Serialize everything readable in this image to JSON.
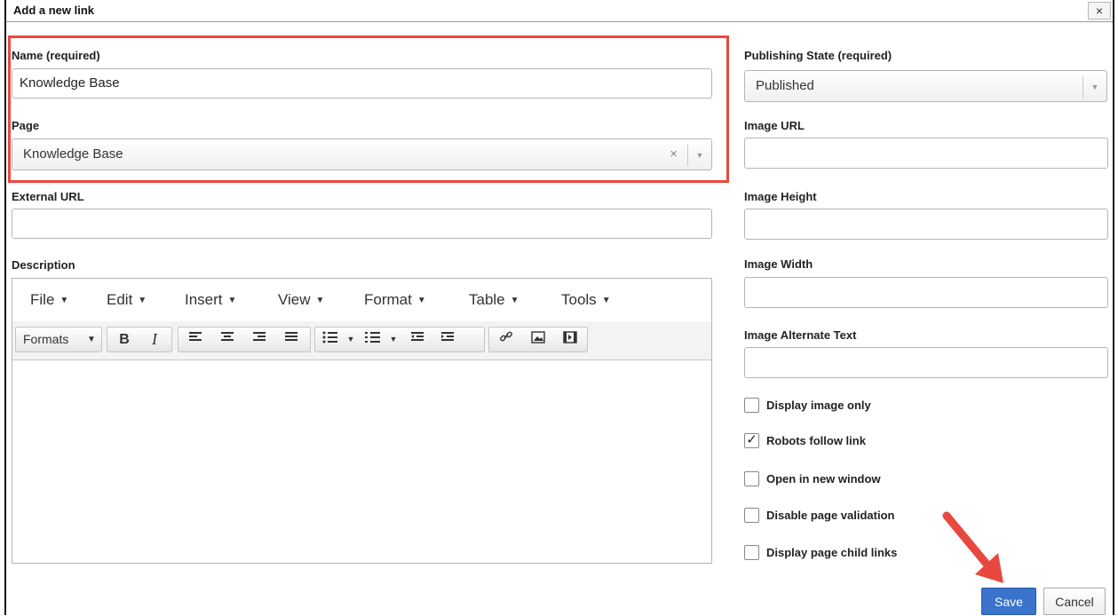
{
  "dialog": {
    "title": "Add a new link",
    "close": "×"
  },
  "left": {
    "name_label": "Name (required)",
    "name_value": "Knowledge Base",
    "page_label": "Page",
    "page_value": "Knowledge Base",
    "page_clear": "×",
    "external_url_label": "External URL",
    "external_url_value": "",
    "description_label": "Description"
  },
  "editor": {
    "menus": [
      "File",
      "Edit",
      "Insert",
      "View",
      "Format",
      "Table",
      "Tools"
    ],
    "toolbar": {
      "formats": "Formats",
      "bold": "B",
      "italic": "I"
    }
  },
  "right": {
    "publishing_label": "Publishing State (required)",
    "publishing_value": "Published",
    "image_url_label": "Image URL",
    "image_height_label": "Image Height",
    "image_width_label": "Image Width",
    "image_alt_label": "Image Alternate Text"
  },
  "checkboxes": [
    {
      "label": "Display image only",
      "checked": false
    },
    {
      "label": "Robots follow link",
      "checked": true
    },
    {
      "label": "Open in new window",
      "checked": false
    },
    {
      "label": "Disable page validation",
      "checked": false
    },
    {
      "label": "Display page child links",
      "checked": false
    }
  ],
  "buttons": {
    "save": "Save",
    "cancel": "Cancel"
  },
  "colors": {
    "highlight": "#e8483f",
    "primary": "#3a73cc",
    "arrow": "#e8483f"
  },
  "icons": {
    "dropdown": "chevron-down-icon",
    "toolbar": [
      "align-left-icon",
      "align-center-icon",
      "align-right-icon",
      "align-justify-icon",
      "bullet-list-icon",
      "numbered-list-icon",
      "outdent-icon",
      "indent-icon",
      "link-icon",
      "image-icon",
      "media-icon"
    ]
  }
}
